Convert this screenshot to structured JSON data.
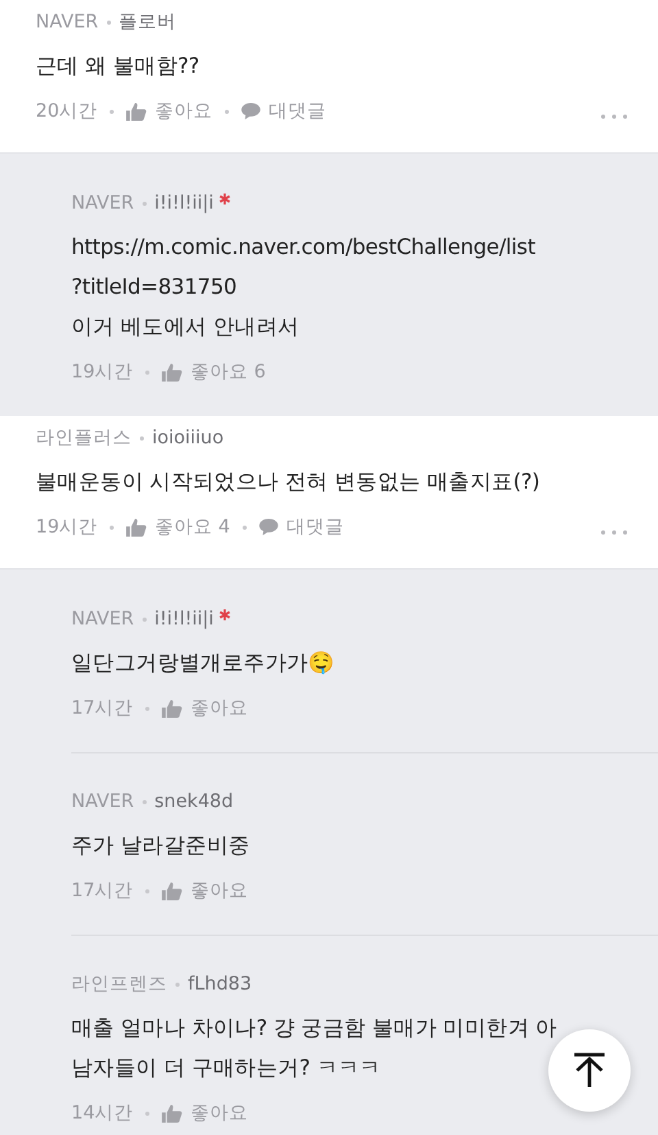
{
  "comments": [
    {
      "kind": "comment",
      "source": "NAVER",
      "username": "플로버",
      "starred": false,
      "lines": [
        "근데 왜 불매함??"
      ],
      "time": "20시간",
      "like_label": "좋아요",
      "reply_label": "대댓글"
    },
    {
      "kind": "reply",
      "source": "NAVER",
      "username": "i!i!l!ii|i",
      "starred": true,
      "lines": [
        "https://m.comic.naver.com/bestChallenge/list",
        "?titleId=831750",
        "이거 베도에서 안내려서"
      ],
      "time": "19시간",
      "like_label": "좋아요",
      "like_count": "6"
    },
    {
      "kind": "comment",
      "source": "라인플러스",
      "username": "ioioiiiuo",
      "starred": false,
      "lines": [
        "불매운동이 시작되었으나 전혀 변동없는 매출지표(?)"
      ],
      "time": "19시간",
      "like_label": "좋아요",
      "like_count": "4",
      "reply_label": "대댓글"
    },
    {
      "kind": "reply",
      "source": "NAVER",
      "username": "i!i!l!ii|i",
      "starred": true,
      "lines": [
        "일단그거랑별개로주가가🤤"
      ],
      "time": "17시간",
      "like_label": "좋아요"
    },
    {
      "kind": "reply",
      "source": "NAVER",
      "username": "snek48d",
      "starred": false,
      "lines": [
        "주가 날라갈준비중"
      ],
      "time": "17시간",
      "like_label": "좋아요"
    },
    {
      "kind": "reply",
      "source": "라인프렌즈",
      "username": "fLhd83",
      "starred": false,
      "lines": [
        "매출 얼마나 차이나? 걍 궁금함 불매가 미미한겨 아",
        "남자들이 더 구매하는거? ㅋㅋㅋ"
      ],
      "time": "14시간",
      "like_label": "좋아요"
    }
  ]
}
